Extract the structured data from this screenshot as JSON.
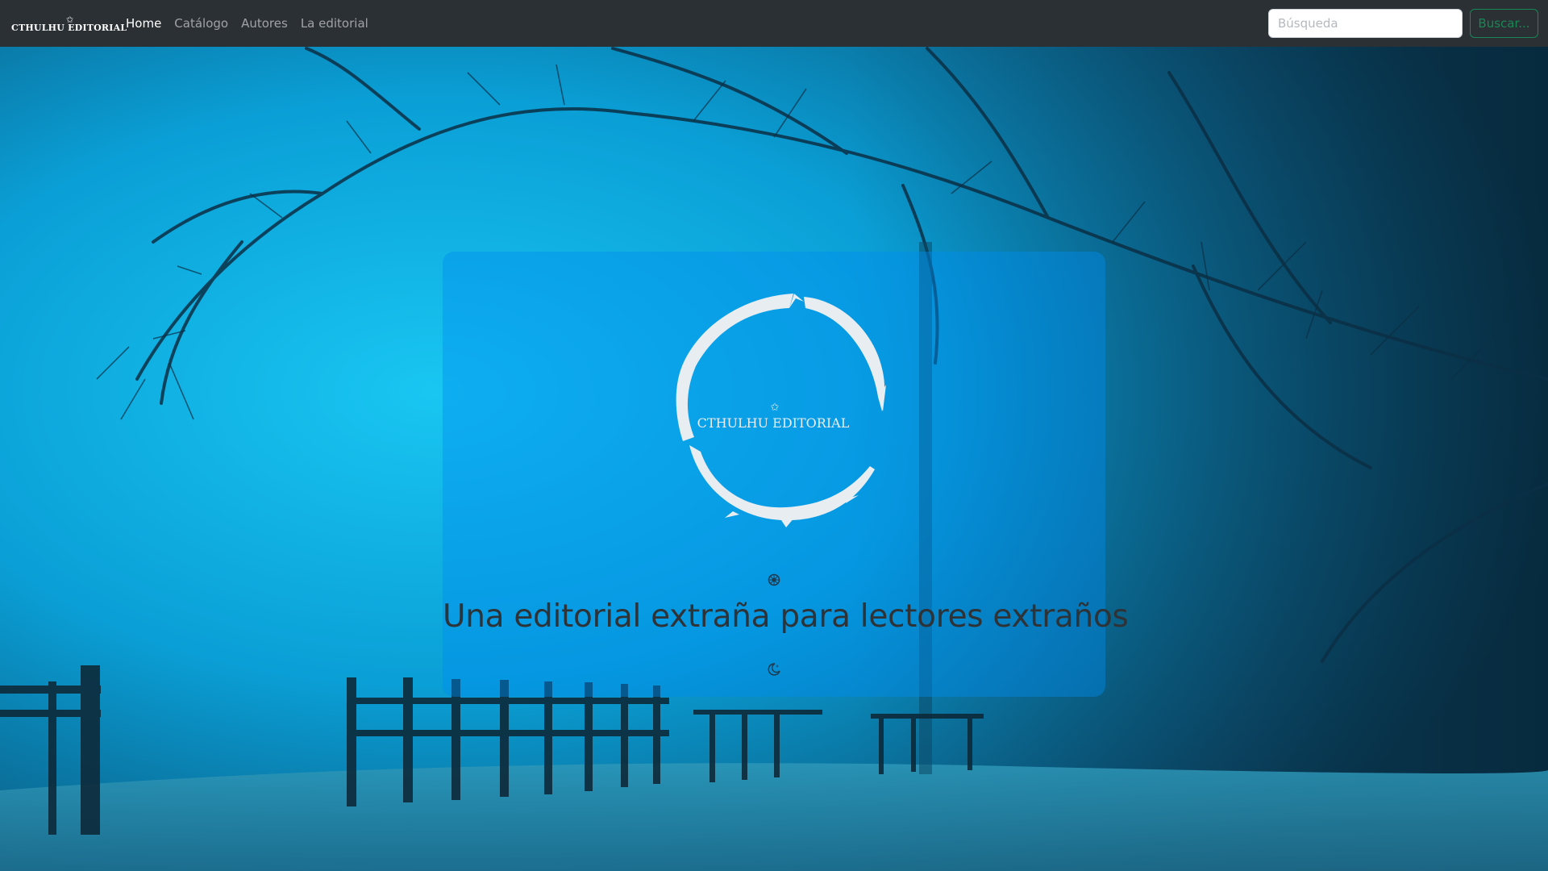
{
  "navbar": {
    "brand": "CTHULHU EDITORIAL",
    "links": [
      "Home",
      "Catálogo",
      "Autores",
      "La editorial"
    ],
    "active_link": "Home",
    "search": {
      "placeholder": "Búsqueda",
      "value": ""
    },
    "search_button": "Buscar..."
  },
  "hero": {
    "logo_text": "CTHULHU EDITORIAL",
    "tagline": "Una editorial extraña para lectores extraños"
  },
  "icons": {
    "brand_star": "star-icon",
    "divider": "compass-icon",
    "footer": "moon-stars-icon"
  },
  "colors": {
    "navbar_bg": "#2b3035",
    "search_button": "#198754",
    "card_bg": "rgba(0,140,240,0.42)",
    "tagline": "#2e3338"
  }
}
